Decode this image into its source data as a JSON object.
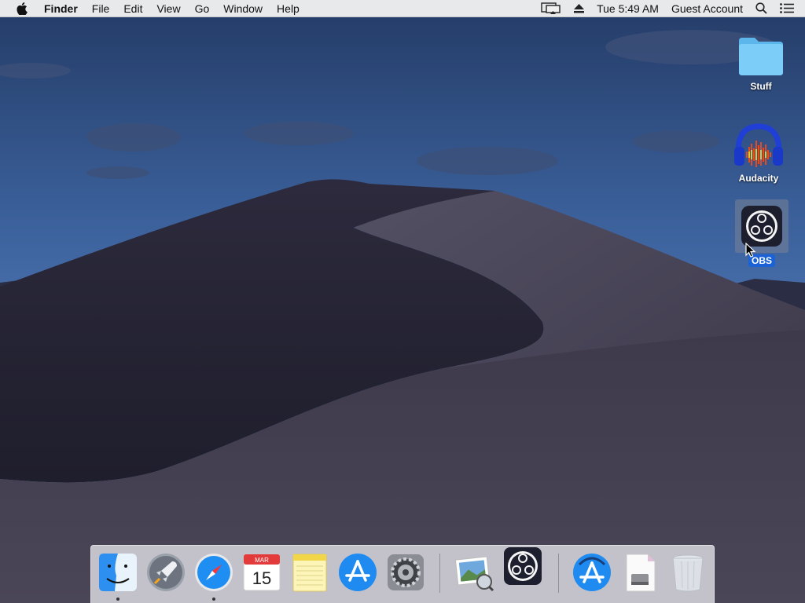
{
  "menubar": {
    "apple_icon": "apple-logo-icon",
    "app_name": "Finder",
    "menus": [
      "File",
      "Edit",
      "View",
      "Go",
      "Window",
      "Help"
    ],
    "status": {
      "display_icon": "airplay-display-icon",
      "eject_icon": "eject-icon",
      "clock": "Tue 5:49 AM",
      "user": "Guest Account",
      "spotlight_icon": "magnifier-icon",
      "notification_icon": "list-icon"
    }
  },
  "desktop": {
    "icons": [
      {
        "label": "Stuff",
        "icon": "folder-icon",
        "selected": false
      },
      {
        "label": "Audacity",
        "icon": "audacity-headphones-icon",
        "selected": false
      },
      {
        "label": "OBS",
        "icon": "obs-icon",
        "selected": true
      }
    ]
  },
  "dock": {
    "items": [
      {
        "name": "Finder",
        "icon": "finder-icon",
        "running": true
      },
      {
        "name": "Launchpad",
        "icon": "rocket-icon",
        "running": false
      },
      {
        "name": "Safari",
        "icon": "compass-icon",
        "running": true
      },
      {
        "name": "Calendar",
        "icon": "calendar-icon",
        "running": false,
        "month": "MAR",
        "day": "15"
      },
      {
        "name": "Notes",
        "icon": "notes-icon",
        "running": false
      },
      {
        "name": "App Store",
        "icon": "app-store-icon",
        "running": false
      },
      {
        "name": "System Preferences",
        "icon": "gear-icon",
        "running": false
      },
      {
        "name": "Preview",
        "icon": "preview-photos-icon",
        "running": false
      },
      {
        "name": "OBS",
        "icon": "obs-icon",
        "running": false
      },
      {
        "name": "App Store Downloads",
        "icon": "app-store-icon",
        "running": false
      },
      {
        "name": "Installer",
        "icon": "installer-disk-icon",
        "running": false
      },
      {
        "name": "Trash",
        "icon": "trash-icon",
        "running": false
      }
    ]
  },
  "colors": {
    "selection": "#1a62d6",
    "folder": "#6cc4f5",
    "sky_top": "#27406e",
    "sky_horizon": "#4a73b2",
    "dune": "#3a3647"
  }
}
